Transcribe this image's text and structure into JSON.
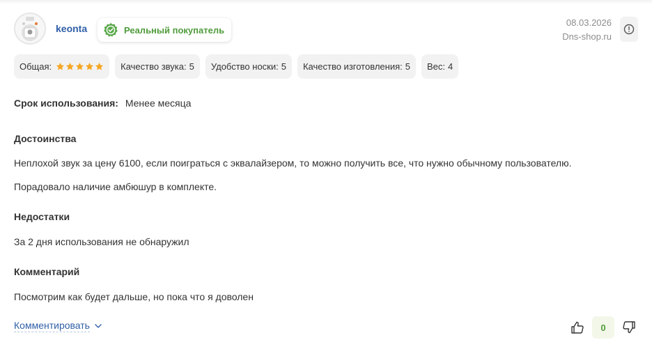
{
  "review": {
    "author": {
      "name": "keonta",
      "verified_badge": "Реальный покупатель"
    },
    "date": "08.03.2026",
    "source": "Dns-shop.ru",
    "ratings": {
      "overall_label": "Общая:",
      "overall_stars": 5,
      "chips": [
        {
          "label": "Качество звука:",
          "value": "5"
        },
        {
          "label": "Удобство носки:",
          "value": "5"
        },
        {
          "label": "Качество изготовления:",
          "value": "5"
        },
        {
          "label": "Вес:",
          "value": "4"
        }
      ]
    },
    "usage": {
      "label": "Срок использования:",
      "value": "Менее месяца"
    },
    "pros": {
      "title": "Достоинства",
      "lines": [
        "Неплохой звук за цену 6100, если поиграться с эквалайзером, то можно получить все, что нужно обычному пользователю.",
        "Порадовало наличие амбюшур в комплекте."
      ]
    },
    "cons": {
      "title": "Недостатки",
      "text": "За 2 дня использования не обнаружил"
    },
    "comment": {
      "title": "Комментарий",
      "text": "Посмотрим как будет дальше, но пока что я доволен"
    },
    "actions": {
      "comment_link": "Комментировать",
      "vote_count": "0"
    },
    "colors": {
      "accent_link": "#2f5fa7",
      "verified_green": "#4f9b3b",
      "star": "#f5a623",
      "chip_bg": "#f2f2f2"
    }
  }
}
